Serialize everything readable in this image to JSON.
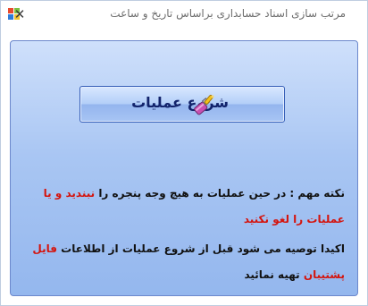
{
  "window": {
    "title": "مرتب سازی اسناد حسابداری براساس تاریخ و ساعت",
    "close_glyph": "✕",
    "app_icon": "windows-form-icon"
  },
  "start_button": {
    "label": "شروع عملیات",
    "icon": "brush-icon"
  },
  "notes": {
    "line1_a": "نکته مهم : در حین عملیات به هیچ وجه پنجره را ",
    "line1_b": "نبندید و یا",
    "line2": "عملیات را لغو نکنید",
    "line3_a": "اکیدا توصیه می شود قبل از شروع عملیات از اطلاعات ",
    "line3_b": "فایل",
    "line4_a": "پشتیبان",
    "line4_b": " تهیه نمائید"
  },
  "colors": {
    "warning_red": "#d4140e",
    "button_text": "#12236b",
    "panel_border": "#6c88cc"
  }
}
